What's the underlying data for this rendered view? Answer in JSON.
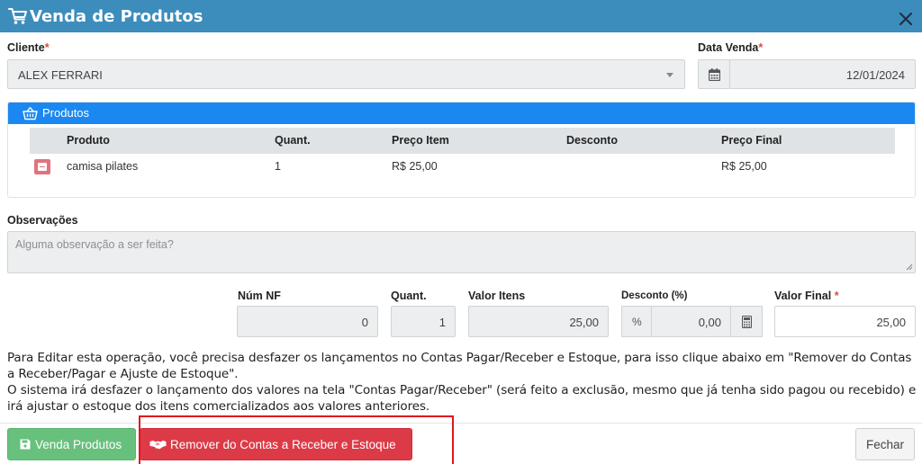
{
  "window": {
    "title": "Venda de Produtos",
    "icons": {
      "cart": "cart-icon",
      "close": "close-icon"
    }
  },
  "form": {
    "cliente_label": "Cliente",
    "cliente_value": "ALEX FERRARI",
    "data_label": "Data Venda",
    "data_value": "12/01/2024",
    "required_mark": "*"
  },
  "produtos": {
    "title": "Produtos",
    "columns": [
      "Produto",
      "Quant.",
      "Preço Item",
      "Desconto",
      "Preço Final"
    ],
    "rows": [
      {
        "produto": "camisa pilates",
        "quant": "1",
        "preco_item": "R$ 25,00",
        "desconto": "",
        "preco_final": "R$ 25,00"
      }
    ]
  },
  "observacoes": {
    "label": "Observações",
    "placeholder": "Alguma observação a ser feita?"
  },
  "totals": {
    "num_nf_label": "Núm NF",
    "num_nf": "0",
    "quant_label": "Quant.",
    "quant": "1",
    "valor_itens_label": "Valor Itens",
    "valor_itens": "25,00",
    "desconto_label": "Desconto (%)",
    "desconto_symbol": "%",
    "desconto": "0,00",
    "valor_final_label": "Valor Final",
    "valor_final": "25,00"
  },
  "info": {
    "line1": "Para Editar esta operação, você precisa desfazer os lançamentos no Contas Pagar/Receber e Estoque, para isso clique abaixo em \"Remover do Contas a Receber/Pagar e Ajuste de Estoque\".",
    "line2": "O sistema irá desfazer o lançamento dos valores na tela \"Contas Pagar/Receber\" (será feito a exclusão, mesmo que já tenha sido pagou ou recebido) e irá ajustar o estoque dos itens comercializados aos valores anteriores."
  },
  "buttons": {
    "venda": "Venda Produtos",
    "remover": "Remover do Contas a Receber e Estoque",
    "fechar": "Fechar"
  },
  "colors": {
    "header": "#3c8dbc",
    "panel_header": "#1a88f0",
    "success": "#68c07d",
    "danger": "#dd3a47",
    "highlight": "#e1151f"
  }
}
